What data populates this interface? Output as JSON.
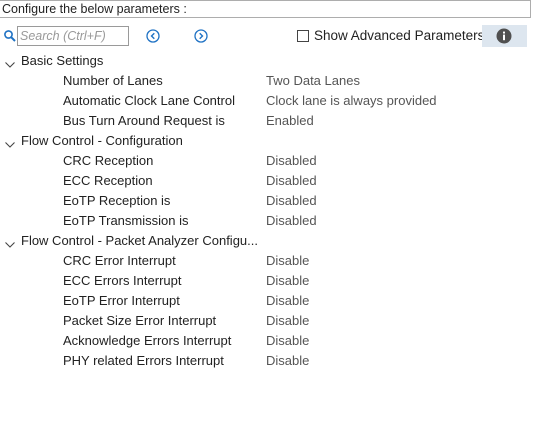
{
  "header": {
    "title": "Configure the below parameters :"
  },
  "toolbar": {
    "search_placeholder": "Search (Ctrl+F)",
    "show_advanced_label": "Show Advanced Parameters",
    "show_advanced_checked": false,
    "icons": {
      "search": "search-icon",
      "prev": "circle-chevron-left-icon",
      "next": "circle-chevron-right-icon",
      "info": "info-icon"
    }
  },
  "colors": {
    "accent_blue": "#1f72c4",
    "info_bg": "#dde6ef"
  },
  "groups": [
    {
      "label": "Basic Settings",
      "expanded": true,
      "params": [
        {
          "name": "Number of Lanes",
          "value": "Two Data Lanes"
        },
        {
          "name": "Automatic Clock Lane Control",
          "value": "Clock lane is always provided"
        },
        {
          "name": "Bus Turn Around Request is",
          "value": "Enabled"
        }
      ]
    },
    {
      "label": "Flow Control - Configuration",
      "expanded": true,
      "params": [
        {
          "name": "CRC Reception",
          "value": "Disabled"
        },
        {
          "name": "ECC Reception",
          "value": "Disabled"
        },
        {
          "name": "EoTP Reception is",
          "value": "Disabled"
        },
        {
          "name": "EoTP Transmission is",
          "value": "Disabled"
        }
      ]
    },
    {
      "label": "Flow Control - Packet Analyzer Configu...",
      "expanded": true,
      "params": [
        {
          "name": "CRC Error Interrupt",
          "value": "Disable"
        },
        {
          "name": "ECC Errors Interrupt",
          "value": "Disable"
        },
        {
          "name": "EoTP Error Interrupt",
          "value": "Disable"
        },
        {
          "name": "Packet Size Error Interrupt",
          "value": "Disable"
        },
        {
          "name": "Acknowledge Errors Interrupt",
          "value": "Disable"
        },
        {
          "name": "PHY related Errors Interrupt",
          "value": "Disable"
        }
      ]
    }
  ]
}
